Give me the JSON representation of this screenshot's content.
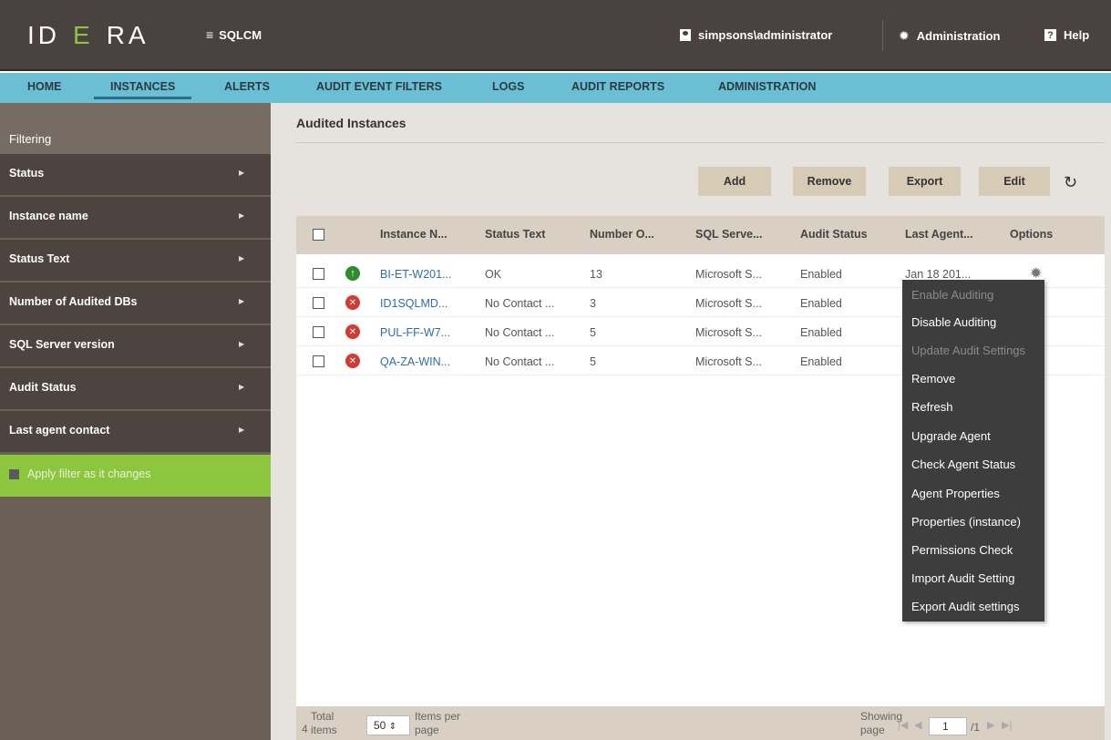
{
  "header": {
    "logo_text_1": "ID",
    "logo_text_2": "E",
    "logo_text_3": "RA",
    "product": "SQLCM",
    "user": "simpsons\\administrator",
    "administration": "Administration",
    "help": "Help"
  },
  "nav": {
    "tabs": [
      "HOME",
      "INSTANCES",
      "ALERTS",
      "AUDIT EVENT FILTERS",
      "LOGS",
      "AUDIT REPORTS",
      "ADMINISTRATION"
    ],
    "active": "INSTANCES"
  },
  "sidebar": {
    "title": "Filtering",
    "filters": [
      "Status",
      "Instance name",
      "Status Text",
      "Number of Audited DBs",
      "SQL Server version",
      "Audit Status",
      "Last agent contact"
    ],
    "apply_label": "Apply filter as it changes"
  },
  "main": {
    "title": "Audited Instances",
    "buttons": {
      "add": "Add",
      "remove": "Remove",
      "export": "Export",
      "edit": "Edit"
    },
    "columns": [
      "Instance N...",
      "Status Text",
      "Number O...",
      "SQL Serve...",
      "Audit Status",
      "Last Agent...",
      "Options"
    ],
    "rows": [
      {
        "status": "ok",
        "instance": "BI-ET-W201...",
        "status_text": "OK",
        "number": "13",
        "sql_server": "Microsoft S...",
        "audit_status": "Enabled",
        "last_agent": "Jan 18 201..."
      },
      {
        "status": "error",
        "instance": "ID1SQLMD...",
        "status_text": "No Contact ...",
        "number": "3",
        "sql_server": "Microsoft S...",
        "audit_status": "Enabled",
        "last_agent": ""
      },
      {
        "status": "error",
        "instance": "PUL-FF-W7...",
        "status_text": "No Contact ...",
        "number": "5",
        "sql_server": "Microsoft S...",
        "audit_status": "Enabled",
        "last_agent": ""
      },
      {
        "status": "error",
        "instance": "QA-ZA-WIN...",
        "status_text": "No Contact ...",
        "number": "5",
        "sql_server": "Microsoft S...",
        "audit_status": "Enabled",
        "last_agent": ""
      }
    ],
    "footer": {
      "total_count": "4",
      "total_label_1": "Total",
      "total_label_2": "items",
      "per_page_value": "50",
      "per_page_label_1": "Items per",
      "per_page_label_2": "page",
      "showing_1": "Showing",
      "showing_2": "page",
      "page_current": "1",
      "page_total": "/1"
    }
  },
  "context_menu": {
    "items": [
      {
        "label": "Enable Auditing",
        "enabled": false
      },
      {
        "label": "Disable Auditing",
        "enabled": true
      },
      {
        "label": "Update Audit Settings",
        "enabled": false
      },
      {
        "label": "Remove",
        "enabled": true
      },
      {
        "label": "Refresh",
        "enabled": true
      },
      {
        "label": "Upgrade Agent",
        "enabled": true
      },
      {
        "label": "Check Agent Status",
        "enabled": true
      },
      {
        "label": "Agent Properties",
        "enabled": true
      },
      {
        "label": "Properties (instance)",
        "enabled": true
      },
      {
        "label": "Permissions Check",
        "enabled": true
      },
      {
        "label": "Import Audit Setting",
        "enabled": true
      },
      {
        "label": "Export Audit settings",
        "enabled": true
      }
    ]
  },
  "colors": {
    "header_bg": "#4a4240",
    "nav_bg": "#6bbfd4",
    "sidebar_bg": "#4d443f",
    "accent_green": "#8cc63f",
    "link": "#2d6ea8",
    "ok": "#2e8b2e",
    "error": "#d23a32"
  },
  "icons": {
    "menu": "hamburger-icon",
    "user": "user-icon",
    "admin": "gear-icon",
    "help": "help-icon",
    "refresh": "refresh-icon",
    "options": "gear-icon",
    "status_ok": "arrow-up-circle-icon",
    "status_error": "x-circle-icon"
  }
}
